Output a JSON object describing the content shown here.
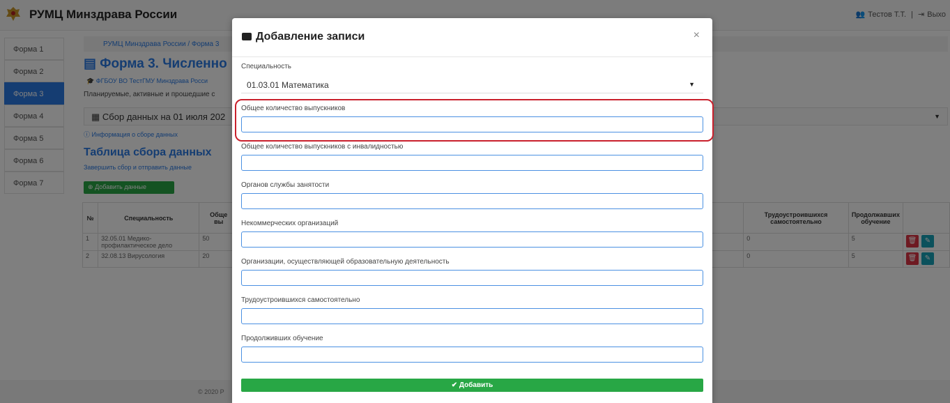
{
  "header": {
    "brand": "РУМЦ Минздрава России",
    "user": "Тестов Т.Т.",
    "separator": "|",
    "logout": "Выхо"
  },
  "sidebar": {
    "items": [
      {
        "label": "Форма 1",
        "active": false
      },
      {
        "label": "Форма 2",
        "active": false
      },
      {
        "label": "Форма 3",
        "active": true
      },
      {
        "label": "Форма 4",
        "active": false
      },
      {
        "label": "Форма 5",
        "active": false
      },
      {
        "label": "Форма 6",
        "active": false
      },
      {
        "label": "Форма 7",
        "active": false
      }
    ]
  },
  "breadcrumb": "РУМЦ Минздрава России / Форма 3",
  "page": {
    "title": "Форма 3. Численно",
    "org": "ФГБОУ ВО ТестГМУ Минздрава Росси",
    "planned": "Планируемые, активные и прошедшие с",
    "collect_select": "Сбор данных на 01 июля 202",
    "info_link": "Информация о сборе данных",
    "table_title": "Таблица сбора данных",
    "finish_link": "Завершить сбор и отправить данные",
    "add_data": "Добавить данные"
  },
  "table": {
    "headers": [
      "№",
      "Специальность",
      "Обще",
      "Трудоустроившихся самостоятельно",
      "Продолжавших обучение"
    ],
    "header_fragment": "вы",
    "rows": [
      {
        "num": "1",
        "spec": "32.05.01 Медико-профилактическое дело",
        "total": "50",
        "self": "0",
        "cont": "5"
      },
      {
        "num": "2",
        "spec": "32.08.13 Вирусология",
        "total": "20",
        "self": "0",
        "cont": "5"
      }
    ]
  },
  "footer": "© 2020 Р",
  "modal": {
    "title": "Добавление записи",
    "close": "×",
    "spec_label": "Специальность",
    "spec_value": "01.03.01 Математика",
    "fields": [
      {
        "label": "Общее количество выпускников",
        "value": ""
      },
      {
        "label": "Общее количество выпускников с инвалидностью",
        "value": ""
      },
      {
        "label": "Органов службы занятости",
        "value": ""
      },
      {
        "label": "Некоммерческих организаций",
        "value": ""
      },
      {
        "label": "Организации, осуществляющей образовательную деятельность",
        "value": ""
      },
      {
        "label": "Трудоустроившихся самостоятельно",
        "value": ""
      },
      {
        "label": "Продолживших обучение",
        "value": ""
      }
    ],
    "submit": "Добавить"
  },
  "colors": {
    "accent": "#2a7ae4",
    "success": "#28a745",
    "danger": "#dc3545",
    "highlight": "#c9202c"
  }
}
